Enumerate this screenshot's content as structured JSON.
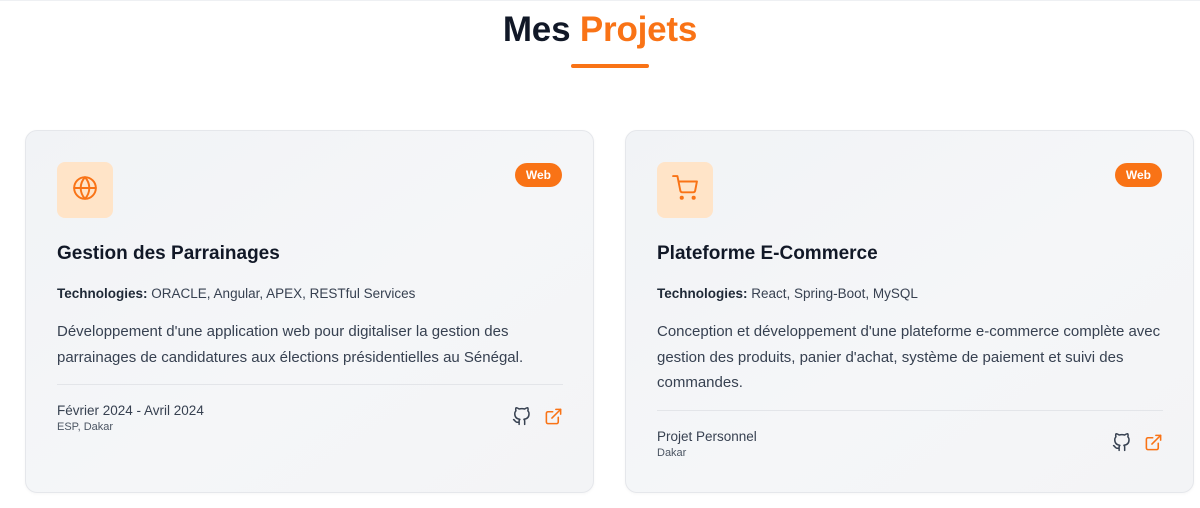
{
  "section": {
    "title_prefix": "Mes",
    "title_accent": "Projets"
  },
  "colors": {
    "accent": "#f97316",
    "icon_bg": "#ffe4c8",
    "card_bg": "#f3f4f6",
    "title": "#111827"
  },
  "projects": [
    {
      "icon": "globe-icon",
      "badge": "Web",
      "title": "Gestion des Parrainages",
      "tech_label": "Technologies:",
      "tech_value": "ORACLE, Angular, APEX, RESTful Services",
      "description": "Développement d'une application web pour digitaliser la gestion des parrainages de candidatures aux élections présidentielles au Sénégal.",
      "date": "Février 2024 - Avril 2024",
      "place": "ESP, Dakar",
      "links": [
        "github-icon",
        "external-link-icon"
      ]
    },
    {
      "icon": "shopping-cart-icon",
      "badge": "Web",
      "title": "Plateforme E-Commerce",
      "tech_label": "Technologies:",
      "tech_value": "React, Spring-Boot, MySQL",
      "description": "Conception et développement d'une plateforme e-commerce complète avec gestion des produits, panier d'achat, système de paiement et suivi des commandes.",
      "date": "Projet Personnel",
      "place": "Dakar",
      "links": [
        "github-icon",
        "external-link-icon"
      ]
    }
  ]
}
